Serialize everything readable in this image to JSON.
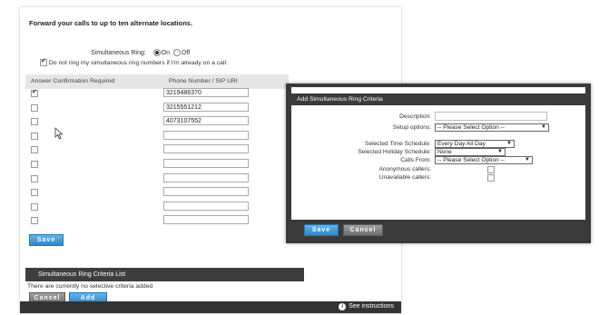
{
  "main": {
    "heading": "Forward your calls to up to ten alternate locations.",
    "simultaneous_ring_label": "Simultaneous Ring:",
    "option_on": "On",
    "option_off": "Off",
    "do_not_ring_label": "Do not ring my simultaneous ring numbers if I'm already on a call:",
    "col_answer_confirmation": "Answer Confirmation Required",
    "col_phone_number": "Phone Number / SIP URI",
    "rows": [
      {
        "checked": true,
        "phone": "3219486370"
      },
      {
        "checked": false,
        "phone": "3215551212"
      },
      {
        "checked": false,
        "phone": "4073107552"
      },
      {
        "checked": false,
        "phone": ""
      },
      {
        "checked": false,
        "phone": ""
      },
      {
        "checked": false,
        "phone": ""
      },
      {
        "checked": false,
        "phone": ""
      },
      {
        "checked": false,
        "phone": ""
      },
      {
        "checked": false,
        "phone": ""
      },
      {
        "checked": false,
        "phone": ""
      }
    ],
    "save_label": "Save",
    "criteria_list_title": "Simultaneous Ring Criteria List",
    "no_criteria_text": "There are currently no selective criteria added",
    "cancel_label": "Cancel",
    "add_label": "Add",
    "see_instructions": "See instructions"
  },
  "dialog": {
    "title": "Add Simultaneous Ring Criteria",
    "description_label": "Description:",
    "setup_options_label": "Setup options:",
    "setup_options_value": "-- Please Select Option --",
    "time_schedule_label": "Selected Time Schedule:",
    "time_schedule_value": "Every Day All Day",
    "holiday_schedule_label": "Selected Holiday Schedule:",
    "holiday_schedule_value": "None",
    "calls_from_label": "Calls From:",
    "calls_from_value": "-- Please Select Option --",
    "anonymous_label": "Anonymous callers:",
    "unavailable_label": "Unavailable callers:",
    "save_label": "Save",
    "cancel_label": "Cancel"
  },
  "colors": {
    "button_blue": "#2f86c9",
    "dark_bar": "#3a3a3a"
  }
}
